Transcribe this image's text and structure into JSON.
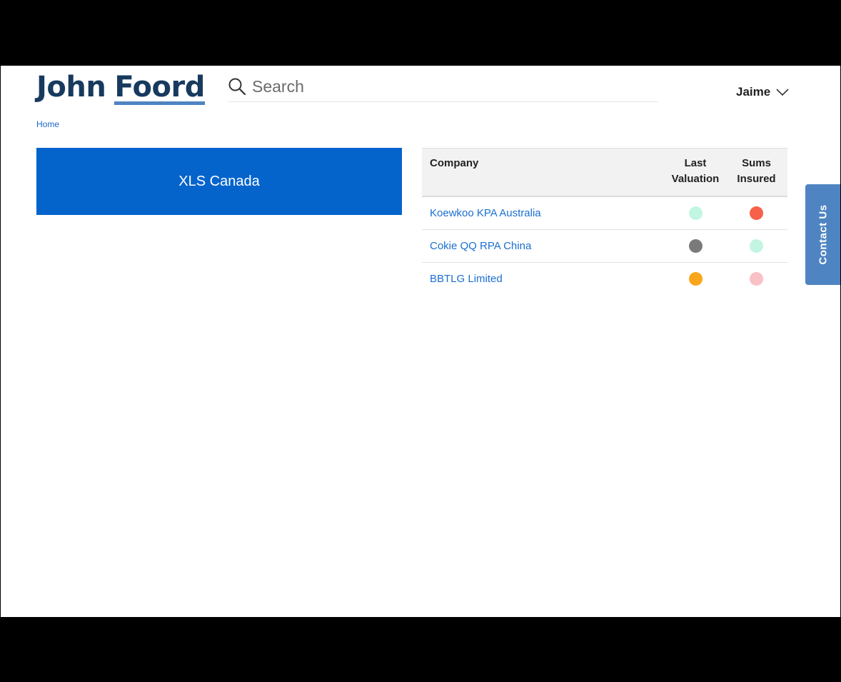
{
  "app": {
    "logo": {
      "word1": "John",
      "word2": "Foord"
    }
  },
  "header": {
    "search": {
      "placeholder": "Search",
      "value": "",
      "icon": "search-icon"
    },
    "user": {
      "name": "Jaime",
      "icon": "chevron-down-icon"
    }
  },
  "breadcrumb": {
    "items": [
      "Home"
    ]
  },
  "company_card": {
    "title": "XLS Canada",
    "color": "#0564cc"
  },
  "table": {
    "headers": {
      "company": "Company",
      "last_valuation_line1": "Last",
      "last_valuation_line2": "Valuation",
      "sums_insured_line1": "Sums",
      "sums_insured_line2": "Insured"
    },
    "rows": [
      {
        "company": "Koewkoo KPA Australia",
        "last_valuation_color": "#c2f5e2",
        "sums_insured_color": "#f7604a"
      },
      {
        "company": "Cokie QQ RPA China",
        "last_valuation_color": "#7a7a7a",
        "sums_insured_color": "#c2f5e2"
      },
      {
        "company": "BBTLG Limited",
        "last_valuation_color": "#f9a61b",
        "sums_insured_color": "#f9c0c6"
      }
    ]
  },
  "contact_tab": {
    "label": "Contact Us",
    "color": "#4f84c2"
  }
}
